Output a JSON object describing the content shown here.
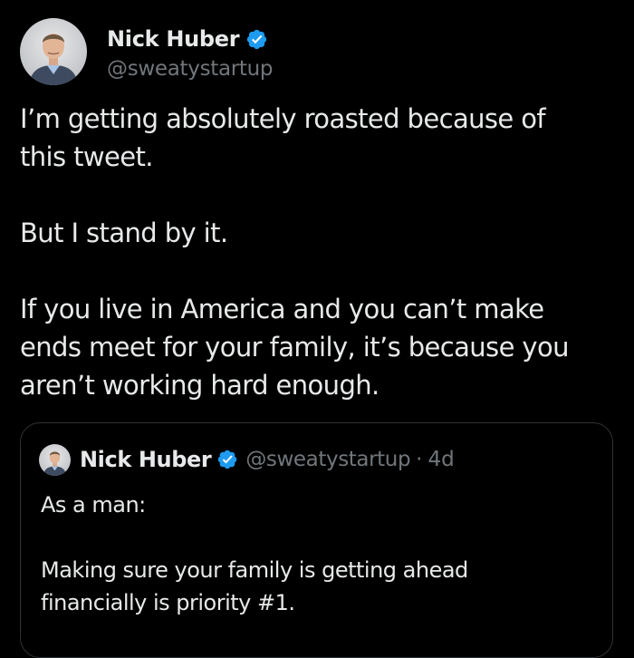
{
  "author": {
    "display_name": "Nick Huber",
    "handle": "@sweatystartup",
    "verified_color": "#1d9bf0"
  },
  "tweet": {
    "paragraphs": [
      [
        "I’m getting absolutely roasted because of",
        "this tweet."
      ],
      [
        "But I stand by it."
      ],
      [
        "If you live in America and you can’t make",
        "ends meet for your family, it’s because you",
        "aren’t working hard enough."
      ]
    ]
  },
  "quote": {
    "display_name": "Nick Huber",
    "handle": "@sweatystartup",
    "separator": "·",
    "time": "4d",
    "paragraphs": [
      [
        "As a man:"
      ],
      [
        "Making sure your family is getting ahead",
        "financially is priority #1."
      ]
    ]
  },
  "colors": {
    "background": "#000000",
    "text_primary": "#e7e9ea",
    "text_secondary": "#71767b",
    "border": "#2f3336",
    "verified": "#1d9bf0"
  },
  "icons": {
    "verified": "verified-badge-icon"
  }
}
